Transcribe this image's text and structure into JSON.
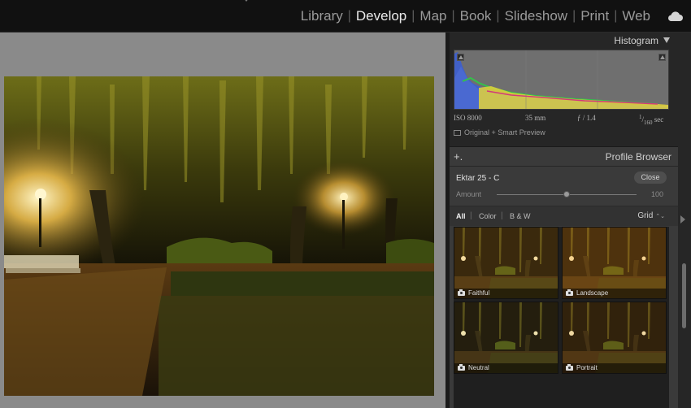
{
  "modules": [
    {
      "label": "Library",
      "active": false
    },
    {
      "label": "Develop",
      "active": true
    },
    {
      "label": "Map",
      "active": false
    },
    {
      "label": "Book",
      "active": false
    },
    {
      "label": "Slideshow",
      "active": false
    },
    {
      "label": "Print",
      "active": false
    },
    {
      "label": "Web",
      "active": false
    }
  ],
  "separator": "|",
  "cloud_icon": "cloud-icon",
  "histogram": {
    "title": "Histogram",
    "iso": "ISO 8000",
    "focal": "35 mm",
    "aperture": "ƒ / 1.4",
    "shutter_num": "1",
    "shutter_den": "160",
    "shutter_unit": "sec",
    "preview_status": "Original + Smart Preview"
  },
  "profile_browser": {
    "plus": "+.",
    "title": "Profile Browser",
    "profile_name": "Ektar 25 - C",
    "close_label": "Close",
    "amount_label": "Amount",
    "amount_value": "100",
    "amount_fraction": 0.5,
    "filters": {
      "all": "All",
      "color": "Color",
      "bw": "B & W"
    },
    "view": "Grid",
    "view_arrow": "⌃⌄"
  },
  "thumbnails": [
    {
      "label": "Faithful"
    },
    {
      "label": "Landscape"
    },
    {
      "label": "Neutral"
    },
    {
      "label": "Portrait"
    }
  ],
  "colors": {
    "accent_text": "#eaeaea",
    "panel": "#262626",
    "canvas_bg": "#8a8a8a"
  }
}
